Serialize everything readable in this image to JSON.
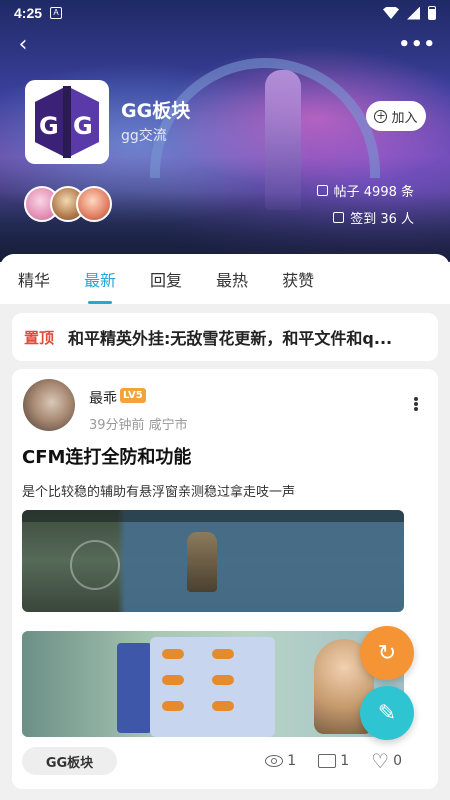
{
  "status_bar": {
    "time": "4:25",
    "notif_icon": "A"
  },
  "forum": {
    "name": "GG板块",
    "subtitle": "gg交流",
    "join_label": "加入",
    "stats": {
      "posts": "帖子 4998 条",
      "checkins": "签到 36 人"
    }
  },
  "tabs": [
    {
      "label": "精华",
      "active": false
    },
    {
      "label": "最新",
      "active": true
    },
    {
      "label": "回复",
      "active": false
    },
    {
      "label": "最热",
      "active": false
    },
    {
      "label": "获赞",
      "active": false
    }
  ],
  "pinned": {
    "tag": "置顶",
    "title": "和平精英外挂:无敌雪花更新，和平文件和q..."
  },
  "post": {
    "username": "最乖",
    "level": "LV5",
    "meta": "39分钟前 咸宁市",
    "title": "CFM连打全防和功能",
    "body": "是个比较稳的辅助有悬浮窗亲测稳过拿走吱一声",
    "tag": "GG板块",
    "views": "1",
    "comments": "1",
    "likes": "0"
  },
  "colors": {
    "accent": "#29a6d6",
    "pinned": "#e14b3b",
    "refresh_fab": "#f49434",
    "edit_fab": "#2fc4d2"
  }
}
